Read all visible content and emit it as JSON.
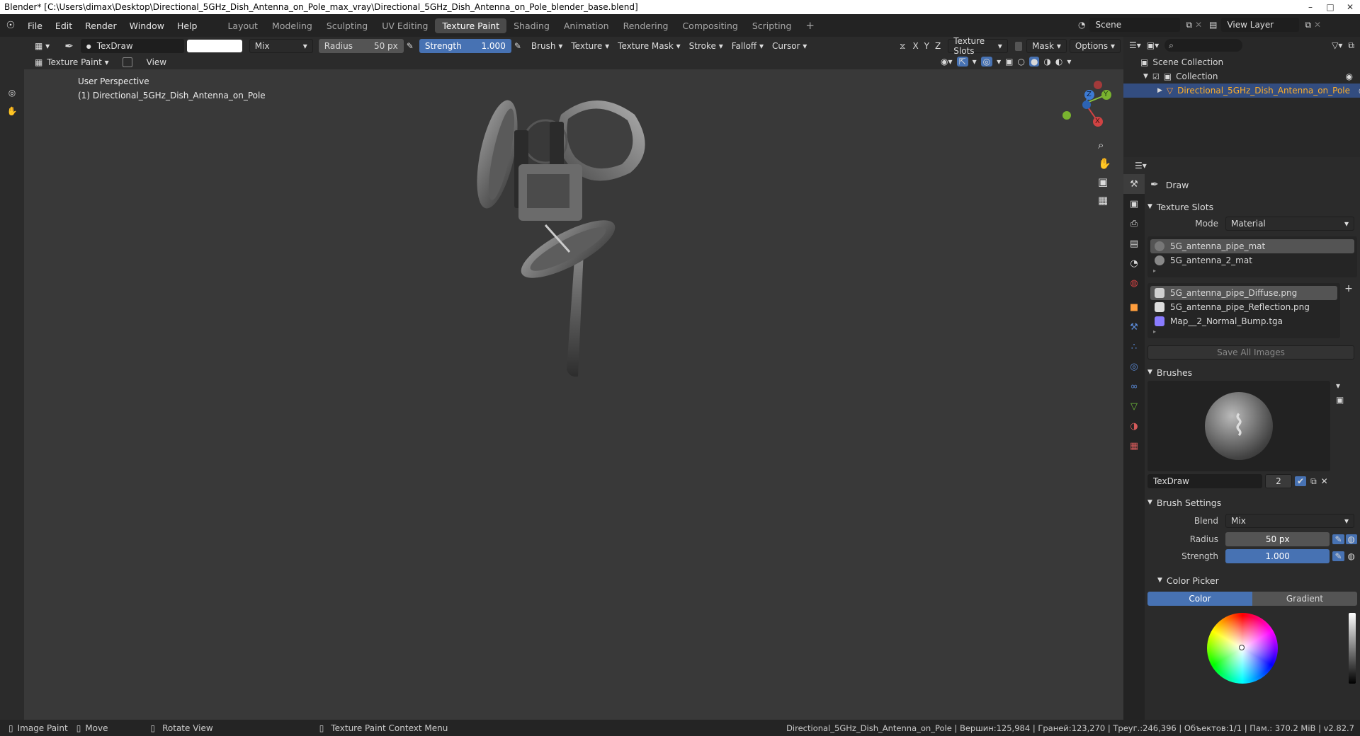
{
  "title_bar": {
    "text": "Blender* [C:\\Users\\dimax\\Desktop\\Directional_5GHz_Dish_Antenna_on_Pole_max_vray\\Directional_5GHz_Dish_Antenna_on_Pole_blender_base.blend]"
  },
  "menus": [
    "File",
    "Edit",
    "Render",
    "Window",
    "Help"
  ],
  "workspaces": [
    "Layout",
    "Modeling",
    "Sculpting",
    "UV Editing",
    "Texture Paint",
    "Shading",
    "Animation",
    "Rendering",
    "Compositing",
    "Scripting"
  ],
  "active_workspace": "Texture Paint",
  "scene": {
    "name": "Scene",
    "view_layer": "View Layer"
  },
  "tool_header": {
    "brush_name": "TexDraw",
    "blend": "Mix",
    "radius_label": "Radius",
    "radius_value": "50 px",
    "strength_label": "Strength",
    "strength_value": "1.000",
    "menus": [
      "Brush",
      "Texture",
      "Texture Mask",
      "Stroke",
      "Falloff",
      "Cursor"
    ],
    "axes": [
      "X",
      "Y",
      "Z"
    ],
    "texture_slots": "Texture Slots",
    "mask": "Mask",
    "options": "Options"
  },
  "mode_header": {
    "mode": "Texture Paint",
    "view": "View"
  },
  "viewport": {
    "perspective": "User Perspective",
    "object_label": "(1) Directional_5GHz_Dish_Antenna_on_Pole",
    "gizmo_axes": [
      "X",
      "Y",
      "Z"
    ]
  },
  "outliner": {
    "root": "Scene Collection",
    "collection": "Collection",
    "object": "Directional_5GHz_Dish_Antenna_on_Pole"
  },
  "properties": {
    "tool_name": "Draw",
    "texture_slots_title": "Texture Slots",
    "mode_label": "Mode",
    "mode_value": "Material",
    "materials": [
      "5G_antenna_pipe_mat",
      "5G_antenna_2_mat"
    ],
    "images": [
      "5G_antenna_pipe_Diffuse.png",
      "5G_antenna_pipe_Reflection.png",
      "Map__2_Normal_Bump.tga"
    ],
    "save_all": "Save All Images",
    "brushes_title": "Brushes",
    "brush_name": "TexDraw",
    "brush_users": "2",
    "brush_settings_title": "Brush Settings",
    "blend_label": "Blend",
    "blend_value": "Mix",
    "radius_label": "Radius",
    "radius_value": "50 px",
    "strength_label": "Strength",
    "strength_value": "1.000",
    "color_picker_title": "Color Picker",
    "color_tab": "Color",
    "gradient_tab": "Gradient"
  },
  "status_bar": {
    "hints": [
      "Image Paint",
      "Move",
      "Rotate View",
      "Texture Paint Context Menu"
    ],
    "stats": "Directional_5GHz_Dish_Antenna_on_Pole | Вершин:125,984 | Граней:123,270 | Треуг.:246,396 | Объектов:1/1 | Пам.: 370.2 MiB | v2.82.7"
  },
  "colors": {
    "accent": "#4772b3",
    "object_selected": "#ff9e3d"
  }
}
